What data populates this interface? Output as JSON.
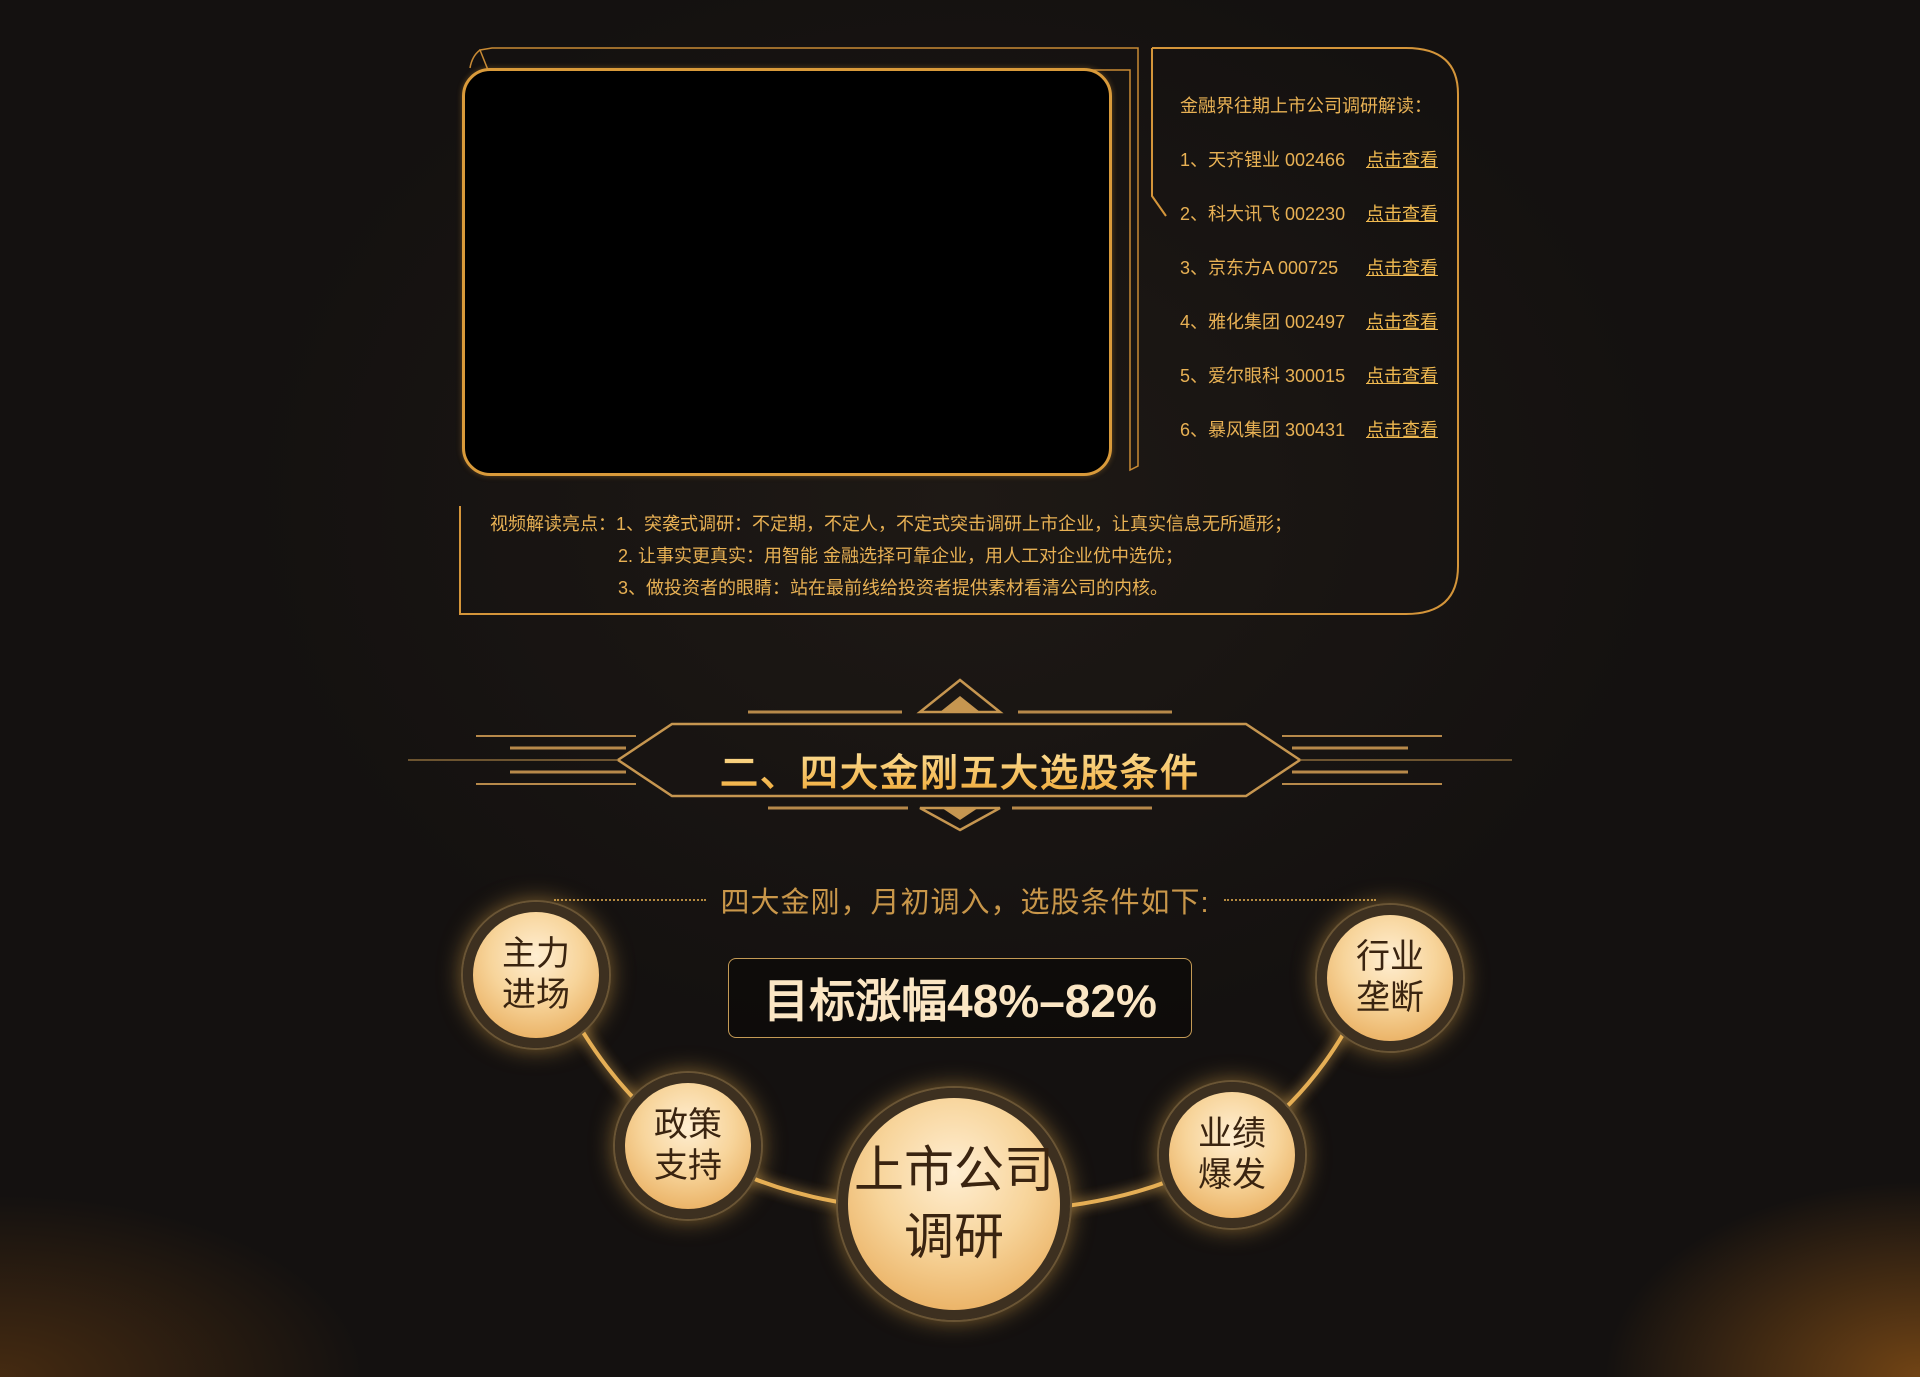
{
  "sidebar": {
    "title": "金融界往期上市公司调研解读：",
    "items": [
      {
        "text": "1、天齐锂业 002466",
        "link": "点击查看"
      },
      {
        "text": "2、科大讯飞 002230",
        "link": "点击查看"
      },
      {
        "text": "3、京东方A 000725",
        "link": "点击查看"
      },
      {
        "text": "4、雅化集团 002497",
        "link": "点击查看"
      },
      {
        "text": "5、爱尔眼科 300015",
        "link": "点击查看"
      },
      {
        "text": "6、暴风集团 300431",
        "link": "点击查看"
      }
    ]
  },
  "highlights": {
    "line1": "视频解读亮点：1、突袭式调研：不定期，不定人，不定式突击调研上市企业，让真实信息无所遁形；",
    "line2": "2. 让事实更真实：用智能 金融选择可靠企业，用人工对企业优中选优；",
    "line3": "3、做投资者的眼睛：站在最前线给投资者提供素材看清公司的内核。"
  },
  "section": {
    "title": "二、四大金刚五大选股条件"
  },
  "conditions": {
    "subtitle": "四大金刚，月初调入，选股条件如下:",
    "target": "目标涨幅48%–82%",
    "circles": {
      "c1": {
        "line1": "主力",
        "line2": "进场"
      },
      "c2": {
        "line1": "政策",
        "line2": "支持"
      },
      "c3": {
        "line1": "上市公司",
        "line2": "调研"
      },
      "c4": {
        "line1": "业绩",
        "line2": "爆发"
      },
      "c5": {
        "line1": "行业",
        "line2": "垄断"
      }
    }
  },
  "colors": {
    "gold": "#e8b154",
    "frame": "#d99a3a",
    "background": "#141110",
    "circle_text": "#3a2410"
  }
}
